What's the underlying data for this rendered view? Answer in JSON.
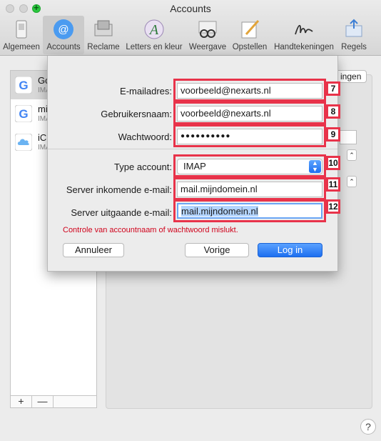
{
  "window": {
    "title": "Accounts"
  },
  "toolbar": {
    "items": [
      {
        "label": "Algemeen"
      },
      {
        "label": "Accounts"
      },
      {
        "label": "Reclame"
      },
      {
        "label": "Letters en kleur"
      },
      {
        "label": "Weergave"
      },
      {
        "label": "Opstellen"
      },
      {
        "label": "Handtekeningen"
      },
      {
        "label": "Regels"
      }
    ]
  },
  "sidebar": {
    "accounts": [
      {
        "name": "Go",
        "sub": "IMA"
      },
      {
        "name": "mi",
        "sub": "IMA"
      },
      {
        "name": "iCl",
        "sub": "IMA"
      }
    ],
    "add_label": "+",
    "remove_label": "—"
  },
  "background": {
    "partial_button": "ingen"
  },
  "sheet": {
    "email": {
      "label": "E-mailadres:",
      "value": "voorbeeld@nexarts.nl",
      "badge": "7"
    },
    "username": {
      "label": "Gebruikersnaam:",
      "value": "voorbeeld@nexarts.nl",
      "badge": "8"
    },
    "password": {
      "label": "Wachtwoord:",
      "value": "●●●●●●●●●●",
      "badge": "9"
    },
    "account_type": {
      "label": "Type account:",
      "value": "IMAP",
      "badge": "10"
    },
    "incoming": {
      "label": "Server inkomende e-mail:",
      "value": "mail.mijndomein.nl",
      "badge": "11"
    },
    "outgoing": {
      "label": "Server uitgaande e-mail:",
      "value": "mail.mijndomein.nl",
      "badge": "12"
    },
    "error": "Controle van accountnaam of wachtwoord mislukt.",
    "buttons": {
      "cancel": "Annuleer",
      "back": "Vorige",
      "login": "Log in"
    }
  },
  "help_label": "?",
  "colors": {
    "highlight": "#e8334a",
    "accent": "#1d6ff0",
    "error": "#d0021b"
  }
}
